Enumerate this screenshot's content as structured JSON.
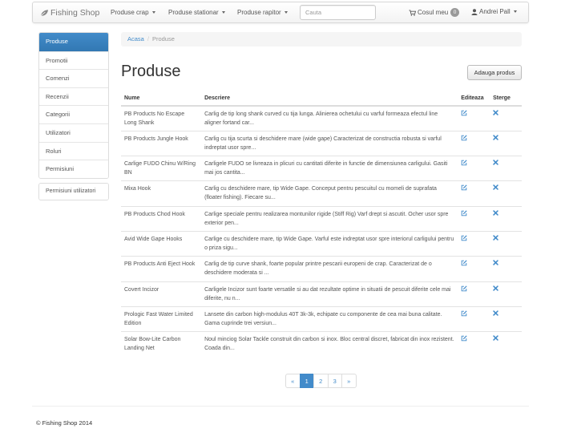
{
  "navbar": {
    "brand": "Fishing Shop",
    "menus": [
      {
        "label": "Produse crap"
      },
      {
        "label": "Produse stationar"
      },
      {
        "label": "Produse rapitor"
      }
    ],
    "search_placeholder": "Cauta",
    "cart_label": "Cosul meu",
    "cart_count": "0",
    "user_name": "Andrei Pall"
  },
  "sidebar": {
    "items": [
      "Produse",
      "Promotii",
      "Comenzi",
      "Recenzii",
      "Categorii",
      "Utilizatori",
      "Roluri",
      "Permisiuni"
    ],
    "extra": "Permisiuni utilizatori"
  },
  "breadcrumb": {
    "home": "Acasa",
    "current": "Produse"
  },
  "page_title": "Produse",
  "add_button": "Adauga produs",
  "table": {
    "headers": {
      "name": "Nume",
      "desc": "Descriere",
      "edit": "Editeaza",
      "delete": "Sterge"
    },
    "rows": [
      {
        "name": "PB Products No Escape Long Shank",
        "desc": "Carlig de tip long shank curved cu tija lunga. Alinierea ochetului cu varful formeaza efectul line aligner fortand car..."
      },
      {
        "name": "PB Products Jungle Hook",
        "desc": "Carlig cu tija scurta si deschidere mare (wide gape) Caracterizat de constructia robusta si varful indreptat usor spre..."
      },
      {
        "name": "Carlige FUDO Chinu W/Ring BN",
        "desc": "Carligele FUDO se livreaza in plicuri cu cantitati diferite in functie de dimensiunea carligului. Gasiti mai jos cantita..."
      },
      {
        "name": "Mixa Hook",
        "desc": "Carlig cu deschidere mare, tip Wide Gape. Conceput pentru pescuitul cu momeli de suprafata (floater fishing). Fiecare su..."
      },
      {
        "name": "PB Products Chod Hook",
        "desc": "Carlige speciale pentru realizarea montunilor rigide (Stiff Rig) Varf drept si ascutit. Ocher usor spre exterior pen..."
      },
      {
        "name": "Avid Wide Gape Hooks",
        "desc": "Carlige cu deschidere mare, tip Wide Gape. Varful este indreptat usor spre interiorul carligului pentru o priza sigu..."
      },
      {
        "name": "PB Products Anti Eject Hook",
        "desc": "Carlig de tip curve shank, foarte popular printre pescarii europeni de crap. Caracterizat de o deschidere moderata si ..."
      },
      {
        "name": "Covert Incizor",
        "desc": "Carligele Incizor sunt foarte versatile si au dat rezultate optime in situatii de pescuit diferite cele mai diferite, nu n..."
      },
      {
        "name": "Prologic Fast Water Limited Edition",
        "desc": "Lansete din carbon high-modulus 40T 3k-3k, echipate cu componente de cea mai buna calitate. Gama cuprinde trei versiun..."
      },
      {
        "name": "Solar Bow-Lite Carbon Landing Net",
        "desc": "Noul minciog Solar Tackle construit din carbon si inox. Bloc central discret, fabricat din inox rezistent. Coada din..."
      }
    ]
  },
  "pagination": {
    "prev": "«",
    "pages": [
      "1",
      "2",
      "3"
    ],
    "next": "»"
  },
  "footer": "© Fishing Shop 2014",
  "colors": {
    "primary": "#428bca",
    "nav_bg": "#f3f3f3"
  }
}
